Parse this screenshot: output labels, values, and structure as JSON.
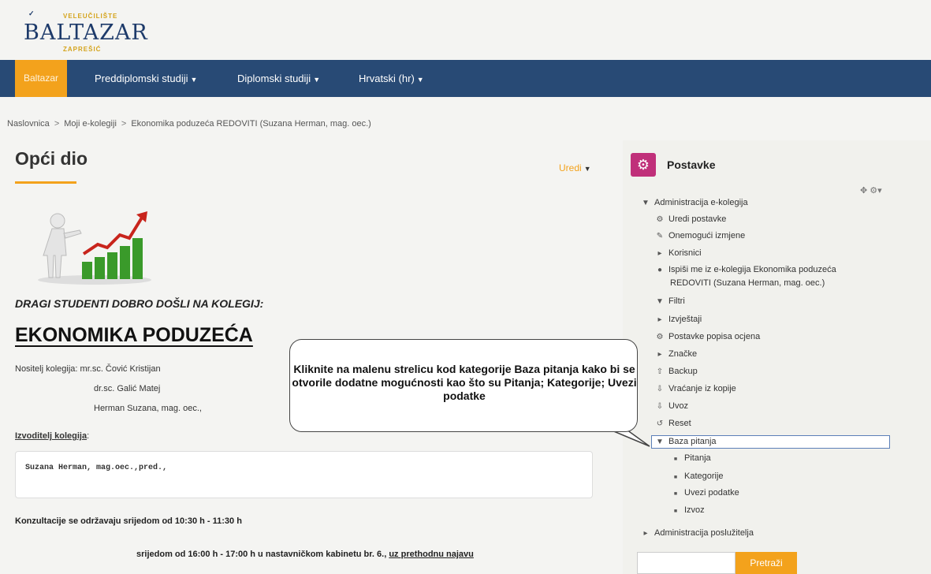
{
  "logo": {
    "mark": "✓",
    "top": "VELEUČILIŠTE",
    "name": "BALTAZAR",
    "sub": "ZAPREŠIĆ"
  },
  "nav": [
    {
      "label": "Baltazar"
    },
    {
      "label": "Preddiplomski studiji"
    },
    {
      "label": "Diplomski studiji"
    },
    {
      "label": "Hrvatski (hr)"
    }
  ],
  "breadcrumb": [
    "Naslovnica",
    "Moji e-kolegiji",
    "Ekonomika poduzeća REDOVITI (Suzana Herman, mag. oec.)"
  ],
  "main": {
    "title": "Opći dio",
    "edit": "Uredi",
    "welcome": "DRAGI STUDENTI DOBRO DOŠLI NA KOLEGIJ:",
    "course": "EKONOMIKA PODUZEĆA",
    "nositelj_label": "Nositelj kolegija: mr.sc. Čović Kristijan",
    "nositelj2": "dr.sc. Galić Matej",
    "nositelj3": "Herman Suzana, mag. oec.,",
    "izvoditelj_label": "Izvoditelj kolegija",
    "izvoditelj_colon": ":",
    "izvoditelj_code": "Suzana Herman, mag.oec.,pred.,",
    "konzultacije1": "Konzultacije se održavaju srijedom od 10:30 h - 11:30 h",
    "konzultacije2": "srijedom od 16:00 h - 17:00 h u nastavničkom kabinetu br. 6., ",
    "konzultacije2_link": "uz prethodnu najavu"
  },
  "callout": {
    "text": "Kliknite na malenu strelicu kod kategorije Baza pitanja kako bi se otvorile dodatne mogućnosti kao što su Pitanja; Kategorije; Uvezi podatke"
  },
  "sidebar": {
    "title": "Postavke",
    "admin_course": "Administracija e-kolegija",
    "items": [
      {
        "icon": "⚙",
        "label": "Uredi postavke"
      },
      {
        "icon": "✎",
        "label": "Onemogući izmjene"
      },
      {
        "icon": "▸",
        "label": "Korisnici"
      },
      {
        "icon": "👤",
        "label": "Ispiši me iz e-kolegija Ekonomika poduzeća"
      },
      {
        "icon": "▼",
        "label": "Filtri"
      },
      {
        "icon": "▸",
        "label": "Izvještaji"
      },
      {
        "icon": "⚙",
        "label": "Postavke popisa ocjena"
      },
      {
        "icon": "▸",
        "label": "Značke"
      },
      {
        "icon": "⇧",
        "label": "Backup"
      },
      {
        "icon": "⇩",
        "label": "Vraćanje iz kopije"
      },
      {
        "icon": "⇩",
        "label": "Uvoz"
      },
      {
        "icon": "↺",
        "label": "Reset"
      }
    ],
    "unenrol_line2": "REDOVITI (Suzana Herman, mag. oec.)",
    "baza": "Baza pitanja",
    "baza_items": [
      "Pitanja",
      "Kategorije",
      "Uvezi podatke",
      "Izvoz"
    ],
    "admin_server": "Administracija poslužitelja",
    "search_button": "Pretraži"
  }
}
